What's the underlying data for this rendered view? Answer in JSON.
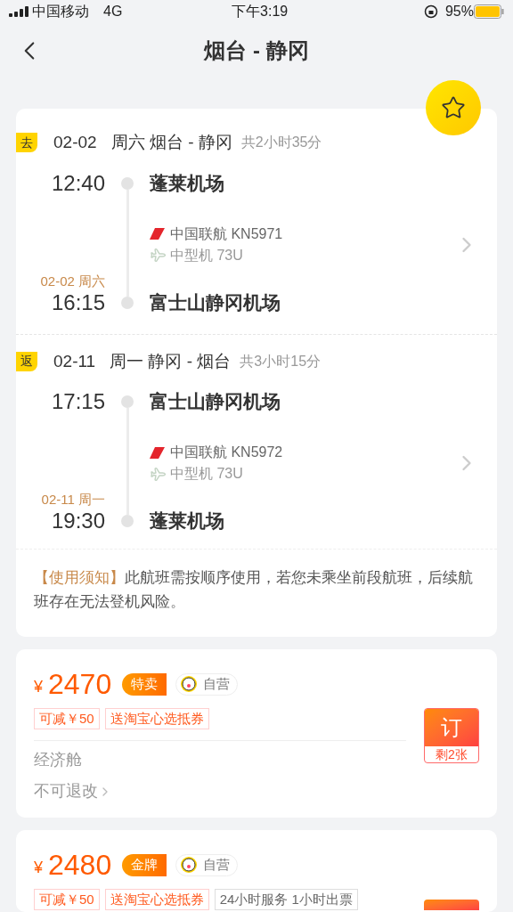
{
  "status_bar": {
    "carrier": "中国移动",
    "network": "4G",
    "time": "下午3:19",
    "battery": "95%"
  },
  "nav": {
    "title": "烟台 - 静冈"
  },
  "favorite": {
    "on": true
  },
  "legs": [
    {
      "badge": "去",
      "date": "02-02",
      "day_route": "周六 烟台 - 静冈",
      "duration": "共2小时35分",
      "dep_time": "12:40",
      "dep_airport": "蓬莱机场",
      "airline": "中国联航 KN5971",
      "aircraft": "中型机 73U",
      "arr_date": "02-02 周六",
      "arr_time": "16:15",
      "arr_airport": "富士山静冈机场"
    },
    {
      "badge": "返",
      "date": "02-11",
      "day_route": "周一 静冈 - 烟台",
      "duration": "共3小时15分",
      "dep_time": "17:15",
      "dep_airport": "富士山静冈机场",
      "airline": "中国联航 KN5972",
      "aircraft": "中型机 73U",
      "arr_date": "02-11 周一",
      "arr_time": "19:30",
      "arr_airport": "蓬莱机场"
    }
  ],
  "notice": "**【使用须知】**此航班需按顺序使用，若您未乘坐前段航班，后续航班存在无法登机风险。",
  "offers": [
    {
      "currency": "¥",
      "price": "2470",
      "badge": "特卖",
      "seller": "自营",
      "tags": [
        {
          "text": "可减￥50",
          "kind": "promo"
        },
        {
          "text": "送淘宝心选抵券",
          "kind": "promo"
        }
      ],
      "cabin": "经济舱",
      "refund": "不可退改",
      "book": "订",
      "remaining": "剩2张"
    },
    {
      "currency": "¥",
      "price": "2480",
      "badge": "金牌",
      "seller": "自营",
      "tags": [
        {
          "text": "可减￥50",
          "kind": "promo"
        },
        {
          "text": "送淘宝心选抵券",
          "kind": "promo"
        },
        {
          "text": "24小时服务 1小时出票",
          "kind": "service"
        }
      ]
    }
  ]
}
